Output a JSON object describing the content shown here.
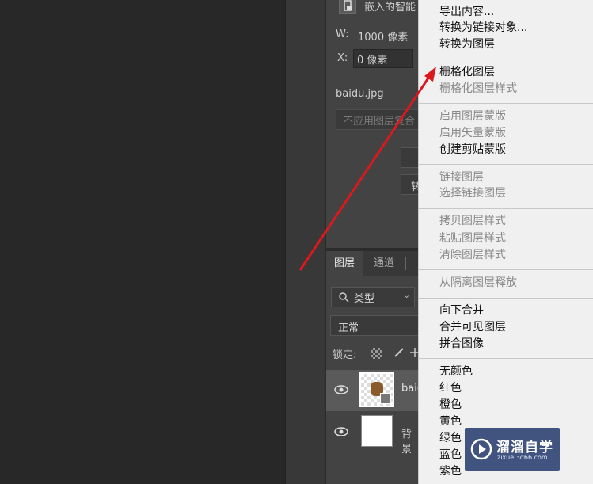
{
  "properties": {
    "smart_object_label": "嵌入的智能",
    "width_label": "W:",
    "width_value": "1000 像素",
    "x_label": "X:",
    "x_value": "0 像素",
    "filename": "baidu.jpg",
    "comp_placeholder": "不应用图层复合"
  },
  "layers_panel": {
    "tabs": [
      {
        "label": "图层",
        "active": true
      },
      {
        "label": "通道",
        "active": false
      }
    ],
    "filter_label": "类型",
    "blend_mode": "正常",
    "lock_label": "锁定:",
    "layers": [
      {
        "name": "baic",
        "selected": true
      },
      {
        "name": "背景",
        "selected": false
      }
    ]
  },
  "context_menu": {
    "items_top": [
      {
        "label": "导出内容...",
        "enabled": true
      },
      {
        "label": "转换为链接对象...",
        "enabled": true
      },
      {
        "label": "转换为图层",
        "enabled": true
      }
    ],
    "group_rasterize": [
      {
        "label": "栅格化图层",
        "enabled": true
      },
      {
        "label": "栅格化图层样式",
        "enabled": false
      }
    ],
    "group_mask": [
      {
        "label": "启用图层蒙版",
        "enabled": false
      },
      {
        "label": "启用矢量蒙版",
        "enabled": false
      },
      {
        "label": "创建剪贴蒙版",
        "enabled": true
      }
    ],
    "group_link": [
      {
        "label": "链接图层",
        "enabled": false
      },
      {
        "label": "选择链接图层",
        "enabled": false
      }
    ],
    "group_style": [
      {
        "label": "拷贝图层样式",
        "enabled": false
      },
      {
        "label": "粘贴图层样式",
        "enabled": false
      },
      {
        "label": "清除图层样式",
        "enabled": false
      }
    ],
    "group_isolate": [
      {
        "label": "从隔离图层释放",
        "enabled": false
      }
    ],
    "group_merge": [
      {
        "label": "向下合并",
        "enabled": true
      },
      {
        "label": "合并可见图层",
        "enabled": true
      },
      {
        "label": "拼合图像",
        "enabled": true
      }
    ],
    "group_colors": [
      {
        "label": "无颜色",
        "enabled": true
      },
      {
        "label": "红色",
        "enabled": true
      },
      {
        "label": "橙色",
        "enabled": true
      },
      {
        "label": "黄色",
        "enabled": true
      },
      {
        "label": "绿色",
        "enabled": true
      },
      {
        "label": "蓝色",
        "enabled": true
      },
      {
        "label": "紫色",
        "enabled": true
      }
    ]
  },
  "watermark": {
    "title": "溜溜自学",
    "subtitle": "zixue.3d66.com"
  },
  "colors": {
    "arrow": "#d9191d",
    "menu_bg": "#f0f0f0",
    "panel_bg": "#434343"
  }
}
